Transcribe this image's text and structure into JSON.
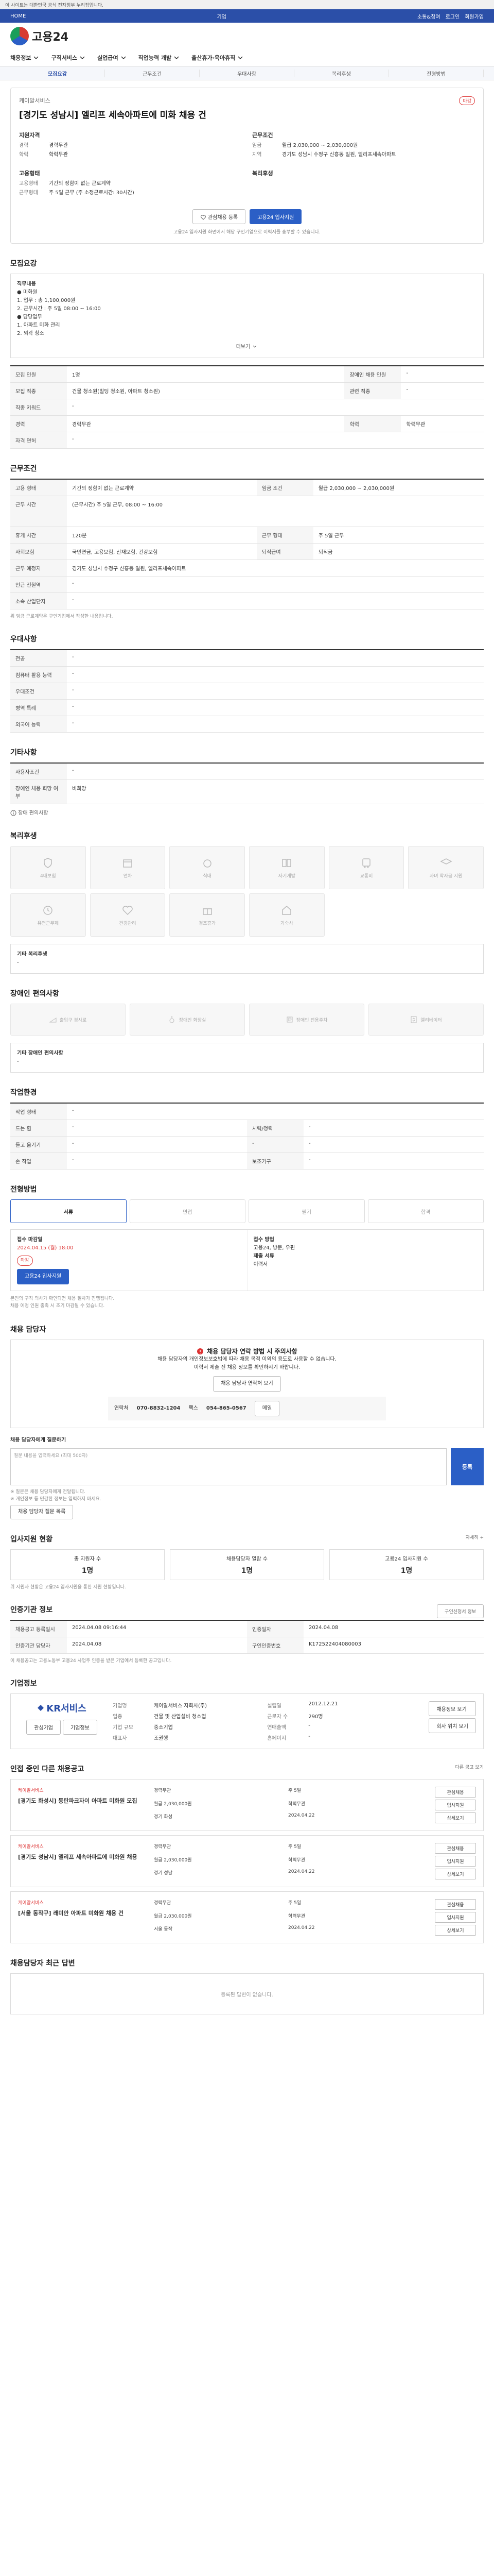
{
  "notice_bar": "이 사이트는 대한민국 공식 전자정부 누리집입니다.",
  "util": {
    "home": "HOME",
    "title": "기업",
    "links": [
      "소통&참여",
      "로그인",
      "회원가입"
    ]
  },
  "brand": {
    "name": "고용24"
  },
  "gnb": [
    "채용정보",
    "구직서비스",
    "실업급여",
    "직업능력 개발",
    "출산휴가·육아휴직"
  ],
  "subtabs": [
    "모집요강",
    "근무조건",
    "우대사항",
    "복리후생",
    "전형방법"
  ],
  "header": {
    "company": "케이알서비스",
    "title": "[경기도 성남시] 엘리프 세속아파트에 미화 채용 건",
    "badge": "마감",
    "req_title": "지원자격",
    "req": [
      {
        "k": "경력",
        "v": "경력무관"
      },
      {
        "k": "학력",
        "v": "학력무관"
      }
    ],
    "cond_title": "근무조건",
    "cond": [
      {
        "k": "임금",
        "v": "월급 2,030,000 ~ 2,030,000원"
      },
      {
        "k": "지역",
        "v": "경기도 성남시 수정구 신흥동 일원, 엘리프세속아파트"
      }
    ],
    "welfare_title": "고용형태",
    "welfare": [
      {
        "k": "고용형태",
        "v": "기간의 정함이 없는 근로계약"
      },
      {
        "k": "근무형태",
        "v": "주 5일 근무 (주 소정근로시간: 30시간)"
      }
    ],
    "benefit_title": "복리후생",
    "btn_scrap": "관심채용 등록",
    "btn_apply": "고용24 입사지원",
    "note": "고용24 입사지원 화면에서 해당 구인기업으로 이력서를 송부할 수 있습니다."
  },
  "recruit": {
    "title": "모집요강",
    "box_title": "직무내용",
    "box_lines": [
      "● 미화원",
      "1. 업무 : 총 1,100,000원",
      "2. 근무시간 : 주 5일 08:00 ~ 16:00",
      "● 담당업무",
      "1. 아파트 미화 관리",
      "2. 외곽 청소"
    ],
    "more": "더보기",
    "rows": [
      {
        "k": "모집 인원",
        "v": "1명",
        "k2": "장애인 채용 인원",
        "v2": "-"
      },
      {
        "k": "모집 직종",
        "v": "건물 청소원(빌딩 청소원, 아파트 청소원)",
        "k2": "관련 직종",
        "v2": "-"
      },
      {
        "k": "직종 키워드",
        "v": "-"
      },
      {
        "k": "경력",
        "v": "경력무관",
        "k2": "학력",
        "v2": "학력무관"
      },
      {
        "k": "자격 면허",
        "v": "-"
      }
    ]
  },
  "work": {
    "title": "근무조건",
    "rows": [
      {
        "k": "고용 형태",
        "v": "기간의 정함이 없는 근로계약",
        "k2": "임금 조건",
        "v2": "월급 2,030,000 ~ 2,030,000원"
      },
      {
        "k": "근무 시간",
        "v": "(근무시간) 주 5일 근무, 08:00 ~ 16:00"
      },
      {
        "k": "휴게 시간",
        "v": "120분",
        "k2": "근무 형태",
        "v2": "주 5일 근무"
      },
      {
        "k": "사회보험",
        "v": "국민연금, 고용보험, 산재보험, 건강보험",
        "k2": "퇴직급여",
        "v2": "퇴직금"
      },
      {
        "k": "근무 예정지",
        "v": "경기도 성남시 수정구 신흥동 일원, 엘리프세속아파트"
      },
      {
        "k": "인근 전철역",
        "v": "-"
      },
      {
        "k": "소속 산업단지",
        "v": "-"
      }
    ],
    "note": "위 임금 근로계약은 구인기업에서 작성한 내용입니다."
  },
  "pref": {
    "title": "우대사항",
    "rows": [
      {
        "k": "전공",
        "v": "-"
      },
      {
        "k": "컴퓨터 활용 능력",
        "v": "-"
      },
      {
        "k": "우대조건",
        "v": "-"
      },
      {
        "k": "병역 특례",
        "v": "-"
      },
      {
        "k": "외국어 능력",
        "v": "-"
      }
    ]
  },
  "etc": {
    "title": "기타사항",
    "rows": [
      {
        "k": "사용자조건",
        "v": "-"
      },
      {
        "k": "장애인 채용 희망 여부",
        "v": "비희망"
      }
    ],
    "more": "장애 편의사항"
  },
  "welfare": {
    "title": "복리후생",
    "tiles": [
      "4대보험",
      "연차",
      "식대",
      "자기개발",
      "교통비",
      "자녀 학자금 지원",
      "유연근무제",
      "건강관리",
      "경조휴가",
      "기숙사"
    ],
    "box_title": "기타 복리후생",
    "box_value": "-"
  },
  "disability": {
    "title": "장애인 편의사항",
    "tiles": [
      "출입구 경사로",
      "장애인 화장실",
      "장애인 전용주차",
      "엘리베이터"
    ],
    "box_title": "기타 장애인 편의사항",
    "box_value": "-"
  },
  "workenv": {
    "title": "작업환경",
    "rows": [
      {
        "k": "작업 형태",
        "v": "-"
      },
      {
        "k": "드는 힘",
        "v": "-",
        "k2": "시력/청력",
        "v2": "-"
      },
      {
        "k": "들고 옮기기",
        "v": "-",
        "k2": "-",
        "v2": "-"
      },
      {
        "k": "손 작업",
        "v": "-",
        "k2": "보조기구",
        "v2": "-"
      }
    ]
  },
  "process": {
    "title": "전형방법",
    "steps": [
      "서류",
      "면접",
      "필기",
      "합격"
    ],
    "left_title": "접수 마감일",
    "left_date": "2024.04.15 (월) 18:00",
    "left_badge": "마감",
    "left_btn": "고용24 입사지원",
    "right_title": "접수 방법",
    "right_lines": [
      "고용24, 방문, 우편",
      "제출 서류",
      "이력서"
    ],
    "notes": [
      "본인의 구직 의사가 확인되면 채용 절차가 진행됩니다.",
      "채용 예정 인원 충족 시 조기 마감될 수 있습니다."
    ]
  },
  "contact": {
    "title": "채용 담당자",
    "warn": "채용 담당자 연락 방법 시 주의사항",
    "lines": [
      "채용 담당자의 개인정보보호법에 따라 채용 목적 이외의 용도로 사용할 수 없습니다.",
      "이력서 제출 전 채용 정보를 확인하시기 바랍니다."
    ],
    "btn": "채용 담당자 연락처 보기",
    "phone_k": "연락처",
    "phone": "070-8832-1204",
    "fax_k": "팩스",
    "fax": "054-865-0567",
    "mail_btn": "메일",
    "q_title": "채용 담당자에게 질문하기",
    "q_placeholder": "질문 내용을 입력하세요 (최대 500자)",
    "q_btn": "등록",
    "q_notes": [
      "※ 질문은 채용 담당자에게 전달됩니다.",
      "※ 개인정보 등 민감한 정보는 입력하지 마세요."
    ],
    "q_link": "채용 담당자 질문 목록"
  },
  "stats": {
    "title": "입사지원 현황",
    "more": "자세히 +",
    "items": [
      {
        "k": "총 지원자 수",
        "v": "1명"
      },
      {
        "k": "채용담당자 열람 수",
        "v": "1명"
      },
      {
        "k": "고용24 입사지원 수",
        "v": "1명"
      }
    ],
    "note": "위 지원자 현황은 고용24 입사지원을 통한 지원 현황입니다."
  },
  "jobinfo": {
    "title": "인증기관 정보",
    "more": "구인신청서 정보",
    "rows": [
      {
        "k": "채용공고 등록일시",
        "v": "2024.04.08 09:16:44",
        "k2": "인증일자",
        "v2": "2024.04.08"
      },
      {
        "k": "인증기관 담당자",
        "v": "2024.04.08",
        "k2": "구인인증번호",
        "v2": "K172522404080003"
      }
    ],
    "note": "이 채용공고는 고용노동부 고용24 사업주 인증을 받은 기업에서 등록한 공고입니다."
  },
  "company": {
    "title": "기업정보",
    "logo": "KR서비스",
    "btn1": "관심기업",
    "btn2": "기업정보",
    "grid": [
      {
        "k": "기업명",
        "v": "케이알서비스 자회사(주)",
        "k2": "설립일",
        "v2": "2012.12.21"
      },
      {
        "k": "업종",
        "v": "건물 및 산업설비 청소업",
        "k2": "근로자 수",
        "v2": "290명"
      },
      {
        "k": "기업 규모",
        "v": "중소기업",
        "k2": "연매출액",
        "v2": "-"
      },
      {
        "k": "대표자",
        "v": "조권행",
        "k2": "홈페이지",
        "v2": "-"
      }
    ],
    "btn3": "채용정보 보기",
    "btn4": "회사 위치 보기"
  },
  "similar": {
    "title": "인접 중인 다른 채용공고",
    "sub": "다른 공고 보기",
    "items": [
      {
        "cn": "케이알서비스",
        "title": "[경기도 화성시] 동탄파크자이 아파트 미화원 모집",
        "d": [
          "경력무관",
          "주 5일",
          "월급 2,030,000원",
          "학력무관",
          "경기 화성",
          "2024.04.22"
        ]
      },
      {
        "cn": "케이알서비스",
        "title": "[경기도 성남시] 엘리프 세속아파트에 미화원 채용",
        "d": [
          "경력무관",
          "주 5일",
          "월급 2,030,000원",
          "학력무관",
          "경기 성남",
          "2024.04.22"
        ]
      },
      {
        "cn": "케이알서비스",
        "title": "[서울 동작구] 래미안 아파트 미화원 채용 건",
        "d": [
          "경력무관",
          "주 5일",
          "월급 2,030,000원",
          "학력무관",
          "서울 동작",
          "2024.04.22"
        ]
      }
    ],
    "btn_a": "관심채용",
    "btn_b": "입사지원",
    "btn_c": "상세보기"
  },
  "recent": {
    "title": "채용담당자 최근 답변",
    "empty": "등록된 답변이 없습니다."
  }
}
